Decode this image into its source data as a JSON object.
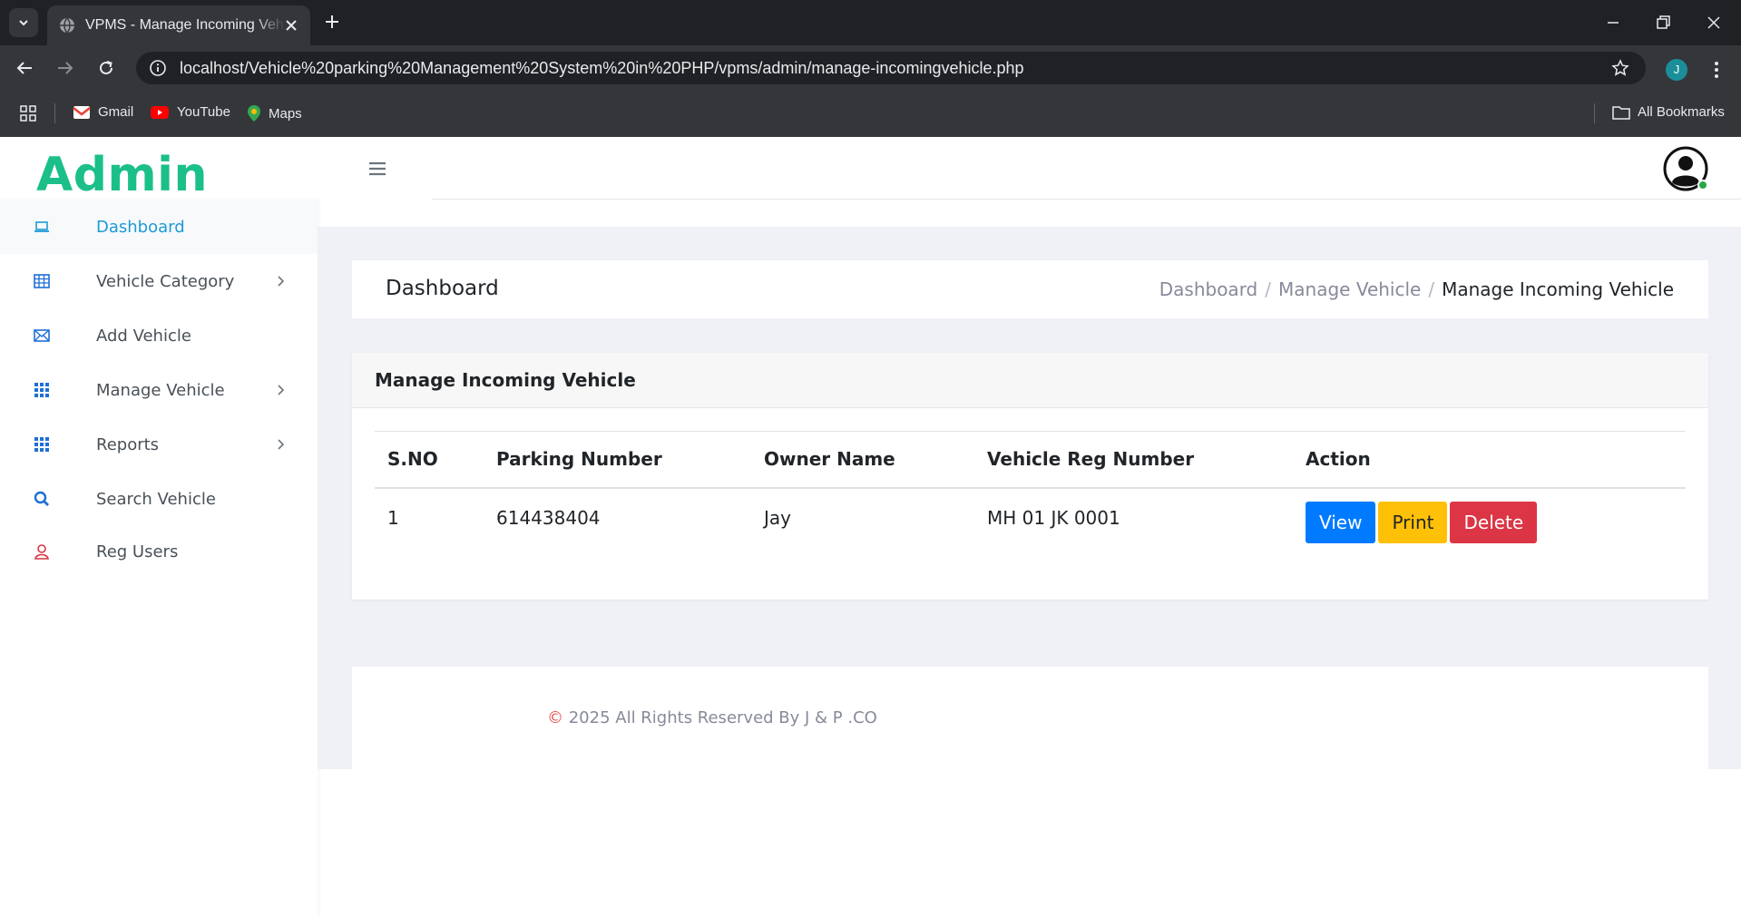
{
  "browser": {
    "tab_title": "VPMS - Manage Incoming Vehicle",
    "url": "localhost/Vehicle%20parking%20Management%20System%20in%20PHP/vpms/admin/manage-incomingvehicle.php",
    "profile_initial": "J",
    "bookmarks": [
      {
        "label": "Gmail",
        "icon": "gmail-icon"
      },
      {
        "label": "YouTube",
        "icon": "youtube-icon"
      },
      {
        "label": "Maps",
        "icon": "maps-icon"
      }
    ],
    "all_bookmarks_label": "All Bookmarks"
  },
  "app": {
    "logo": "Admin",
    "brand_color": "#1bbf8a"
  },
  "sidebar": {
    "items": [
      {
        "label": "Dashboard",
        "icon": "laptop-icon",
        "active": true
      },
      {
        "label": "Vehicle Category",
        "icon": "table-icon",
        "has_submenu": true
      },
      {
        "label": "Add Vehicle",
        "icon": "envelope-icon"
      },
      {
        "label": "Manage Vehicle",
        "icon": "grid-icon",
        "has_submenu": true
      },
      {
        "label": "Reports",
        "icon": "grid-icon",
        "has_submenu": true
      },
      {
        "label": "Search Vehicle",
        "icon": "search-icon"
      },
      {
        "label": "Reg Users",
        "icon": "user-icon"
      }
    ]
  },
  "page_header": {
    "title": "Dashboard",
    "breadcrumb": [
      "Dashboard",
      "Manage Vehicle",
      "Manage Incoming Vehicle"
    ]
  },
  "card": {
    "title": "Manage Incoming Vehicle",
    "columns": [
      "S.NO",
      "Parking Number",
      "Owner Name",
      "Vehicle Reg Number",
      "Action"
    ],
    "rows": [
      {
        "sno": "1",
        "parking_number": "614438404",
        "owner_name": "Jay",
        "reg_number": "MH 01 JK 0001"
      }
    ],
    "actions": {
      "view": "View",
      "print": "Print",
      "delete": "Delete"
    }
  },
  "footer": {
    "copyright_symbol": "©",
    "text": " 2025 All Rights Reserved By J & P .CO"
  }
}
